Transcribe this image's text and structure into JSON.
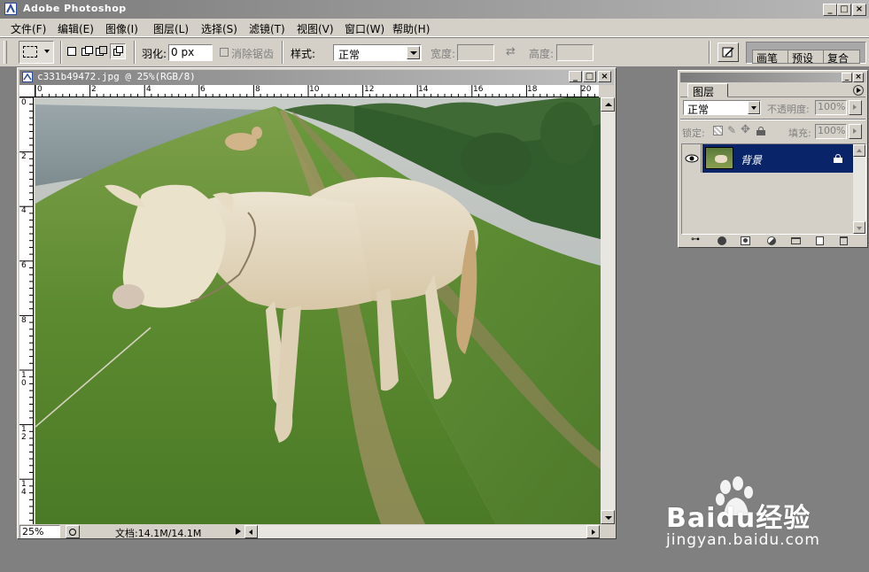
{
  "app": {
    "title": "Adobe Photoshop"
  },
  "window_controls": {
    "minimize": "_",
    "maximize": "□",
    "close": "×"
  },
  "menu": [
    {
      "label": "文件(F)"
    },
    {
      "label": "编辑(E)"
    },
    {
      "label": "图像(I)"
    },
    {
      "label": "图层(L)"
    },
    {
      "label": "选择(S)"
    },
    {
      "label": "滤镜(T)"
    },
    {
      "label": "视图(V)"
    },
    {
      "label": "窗口(W)"
    },
    {
      "label": "帮助(H)"
    }
  ],
  "options": {
    "feather_label": "羽化:",
    "feather_value": "0 px",
    "antialias_label": "消除锯齿",
    "style_label": "样式:",
    "style_value": "正常",
    "width_label": "宽度:",
    "height_label": "高度:",
    "palette_tabs": [
      "画笔",
      "预设",
      "复合"
    ]
  },
  "document": {
    "title": "c331b49472.jpg @ 25%(RGB/8)",
    "zoom": "25%",
    "doc_info": "文档:14.1M/14.1M",
    "hruler_labels": [
      "0",
      "2",
      "4",
      "6",
      "8",
      "10",
      "12",
      "14",
      "16",
      "18",
      "20"
    ],
    "vruler_labels": [
      "0",
      "2",
      "4",
      "6",
      "8",
      "10",
      "12",
      "14"
    ]
  },
  "layers_panel": {
    "tab": "图层",
    "blend_mode": "正常",
    "opacity_label": "不透明度:",
    "opacity_value": "100%",
    "lock_label": "锁定:",
    "fill_label": "填充:",
    "fill_value": "100%",
    "layer_name": "背景"
  },
  "watermark": {
    "brand": "Baidu经验",
    "url": "jingyan.baidu.com"
  },
  "colors": {
    "layer_selected": "#0a246a",
    "chrome": "#d4d0c8",
    "workspace": "#808080"
  }
}
